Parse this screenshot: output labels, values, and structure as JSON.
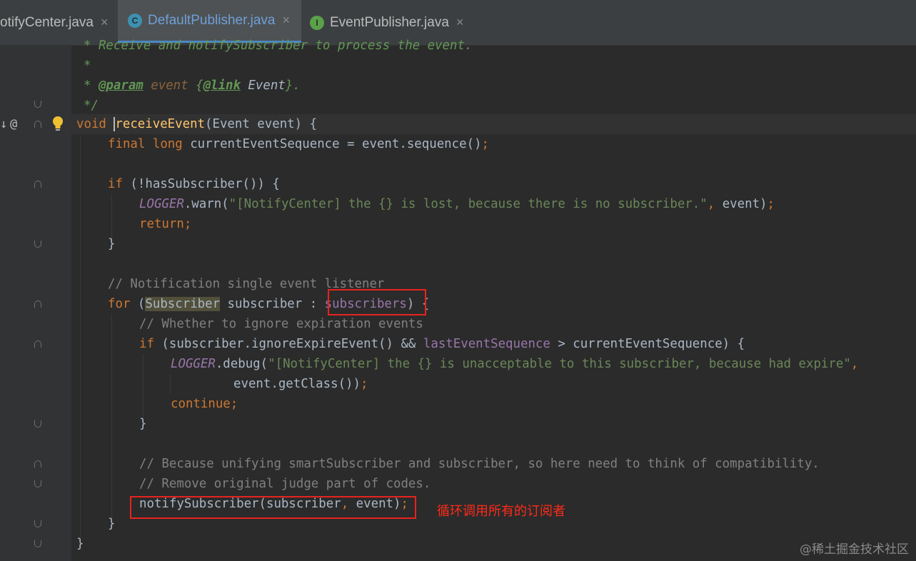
{
  "tabs": [
    {
      "label": "otifyCenter.java",
      "close": "×",
      "icon": "java-class-icon"
    },
    {
      "label": "DefaultPublisher.java",
      "close": "×",
      "badge": "C",
      "active": true
    },
    {
      "label": "EventPublisher.java",
      "close": "×",
      "badge": "I"
    }
  ],
  "gutter": {
    "override_icon": "↓",
    "annotation_icon": "@"
  },
  "code": {
    "l1": "* Receive and notifySubscriber to process the event.",
    "l2": "*",
    "l3_star": "* ",
    "l3_tag": "@param",
    "l3_param": "event",
    "l3_link_open": "{",
    "l3_link_tag": "@link",
    "l3_link_ref": " Event",
    "l3_link_close": "}.",
    "l4": "*/",
    "l5_kw": "void",
    "l5_fn": "receiveEvent",
    "l5_rest": "(Event event) {",
    "l6_kw1": "final",
    "l6_kw2": "long",
    "l6_rest": " currentEventSequence = event.sequence()",
    "l6_semi": ";",
    "l8_kw": "if",
    "l8_rest": " (!hasSubscriber()) {",
    "l9_logger": "LOGGER",
    "l9_call": ".warn(",
    "l9_str": "\"[NotifyCenter] the {} is lost, because there is no subscriber.\"",
    "l9_comma": ",",
    "l9_rest": " event)",
    "l9_semi": ";",
    "l10_kw": "return",
    "l10_semi": ";",
    "l11": "}",
    "l13": "// Notification single event listener",
    "l14_kw": "for",
    "l14_open": " (",
    "l14_type": "Subscriber",
    "l14_var": " subscriber : ",
    "l14_field": "subscribers",
    "l14_close": ") {",
    "l15": "// Whether to ignore expiration events",
    "l16_kw": "if",
    "l16_a": " (subscriber.ignoreExpireEvent() && ",
    "l16_field": "lastEventSequence",
    "l16_b": " > currentEventSequence) {",
    "l17_logger": "LOGGER",
    "l17_call": ".debug(",
    "l17_str": "\"[NotifyCenter] the {} is unacceptable to this subscriber, because had expire\"",
    "l17_comma": ",",
    "l18": "event.getClass())",
    "l18_semi": ";",
    "l19_kw": "continue",
    "l19_semi": ";",
    "l20": "}",
    "l22": "// Because unifying smartSubscriber and subscriber, so here need to think of compatibility.",
    "l23": "// Remove original judge part of codes.",
    "l24_a": "notifySubscriber(subscriber",
    "l24_comma": ",",
    "l24_b": " event)",
    "l24_semi": ";",
    "l25": "}",
    "l26": "}"
  },
  "annotation_text": "循环调用所有的订阅者",
  "watermark": "@稀土掘金技术社区"
}
